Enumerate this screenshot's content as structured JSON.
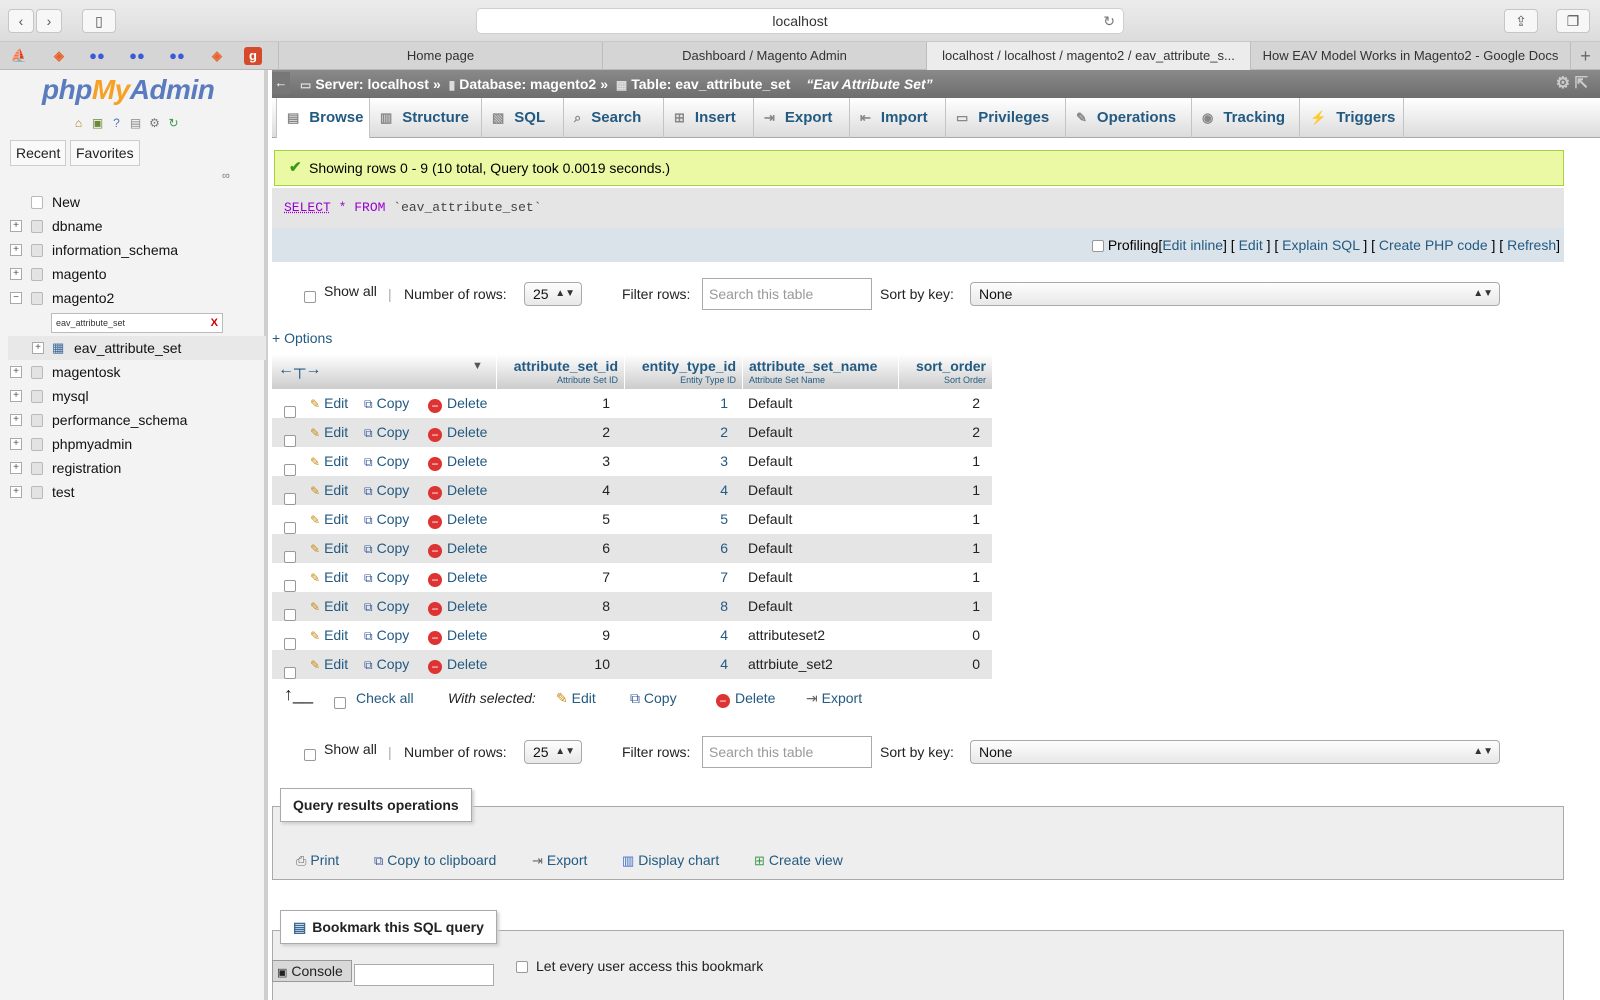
{
  "browser": {
    "url": "localhost",
    "tabs": [
      {
        "label": "Home page"
      },
      {
        "label": "Dashboard / Magento Admin"
      },
      {
        "label": "localhost / localhost / magento2 / eav_attribute_s..."
      },
      {
        "label": "How EAV Model Works in Magento2 - Google Docs"
      }
    ],
    "new_tab": "+"
  },
  "sidebar": {
    "logo_php": "php",
    "logo_my": "My",
    "logo_admin": "Admin",
    "tabs": {
      "recent": "Recent",
      "favorites": "Favorites"
    },
    "tree": {
      "new": "New",
      "dbs": [
        "dbname",
        "information_schema",
        "magento",
        "magento2"
      ],
      "filter_value": "eav_attribute_set",
      "filter_clear": "X",
      "table": "eav_attribute_set",
      "dbs_after": [
        "magentosk",
        "mysql",
        "performance_schema",
        "phpmyadmin",
        "registration",
        "test"
      ]
    }
  },
  "breadcrumb": {
    "server": "Server: localhost",
    "database": "Database: magento2",
    "table": "Table: eav_attribute_set",
    "comment": "“Eav Attribute Set”",
    "sep": "»"
  },
  "menu": {
    "browse": "Browse",
    "structure": "Structure",
    "sql": "SQL",
    "search": "Search",
    "insert": "Insert",
    "export": "Export",
    "import": "Import",
    "privileges": "Privileges",
    "operations": "Operations",
    "tracking": "Tracking",
    "triggers": "Triggers"
  },
  "status": {
    "message": "Showing rows 0 - 9 (10 total, Query took 0.0019 seconds.)"
  },
  "query": {
    "select": "SELECT",
    "star": "*",
    "from": "FROM",
    "table": "`eav_attribute_set`"
  },
  "profiling": {
    "label": "Profiling",
    "edit_inline": "Edit inline",
    "edit": "Edit",
    "explain": "Explain SQL",
    "php": "Create PHP code",
    "refresh": "Refresh"
  },
  "nav": {
    "show_all": "Show all",
    "divider": "|",
    "rows_label": "Number of rows:",
    "rows_value": "25",
    "filter_label": "Filter rows:",
    "filter_placeholder": "Search this table",
    "sort_label": "Sort by key:",
    "sort_value": "None"
  },
  "options_link": "+ Options",
  "table": {
    "columns": [
      {
        "name": "attribute_set_id",
        "comment": "Attribute Set ID"
      },
      {
        "name": "entity_type_id",
        "comment": "Entity Type ID"
      },
      {
        "name": "attribute_set_name",
        "comment": "Attribute Set Name"
      },
      {
        "name": "sort_order",
        "comment": "Sort Order"
      }
    ],
    "actions": {
      "edit": "Edit",
      "copy": "Copy",
      "delete": "Delete"
    },
    "rows": [
      [
        "1",
        "1",
        "Default",
        "2"
      ],
      [
        "2",
        "2",
        "Default",
        "2"
      ],
      [
        "3",
        "3",
        "Default",
        "1"
      ],
      [
        "4",
        "4",
        "Default",
        "1"
      ],
      [
        "5",
        "5",
        "Default",
        "1"
      ],
      [
        "6",
        "6",
        "Default",
        "1"
      ],
      [
        "7",
        "7",
        "Default",
        "1"
      ],
      [
        "8",
        "8",
        "Default",
        "1"
      ],
      [
        "9",
        "4",
        "attributeset2",
        "0"
      ],
      [
        "10",
        "4",
        "attrbiute_set2",
        "0"
      ]
    ]
  },
  "bulk": {
    "check_all": "Check all",
    "with_selected": "With selected:",
    "edit": "Edit",
    "copy": "Copy",
    "delete": "Delete",
    "export": "Export"
  },
  "qro": {
    "legend": "Query results operations",
    "print": "Print",
    "copy": "Copy to clipboard",
    "export": "Export",
    "chart": "Display chart",
    "view": "Create view"
  },
  "bookmark": {
    "legend": "Bookmark this SQL query",
    "shared": "Let every user access this bookmark"
  },
  "console": "Console"
}
